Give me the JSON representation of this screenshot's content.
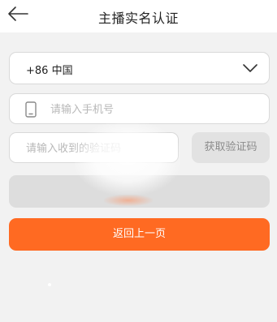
{
  "header": {
    "title": "主播实名认证",
    "back_icon": "arrow-left-icon"
  },
  "form": {
    "country_code": "+86 中国",
    "country_chevron_icon": "chevron-down-icon",
    "phone_icon": "phone-icon",
    "phone_placeholder": "请输入手机号",
    "code_placeholder": "请输入收到的验证码",
    "get_code_label": "获取验证码",
    "back_page_label": "返回上一页"
  },
  "colors": {
    "accent": "#ff6a22",
    "disabled": "#dddddd",
    "background": "#f2f2f2"
  }
}
